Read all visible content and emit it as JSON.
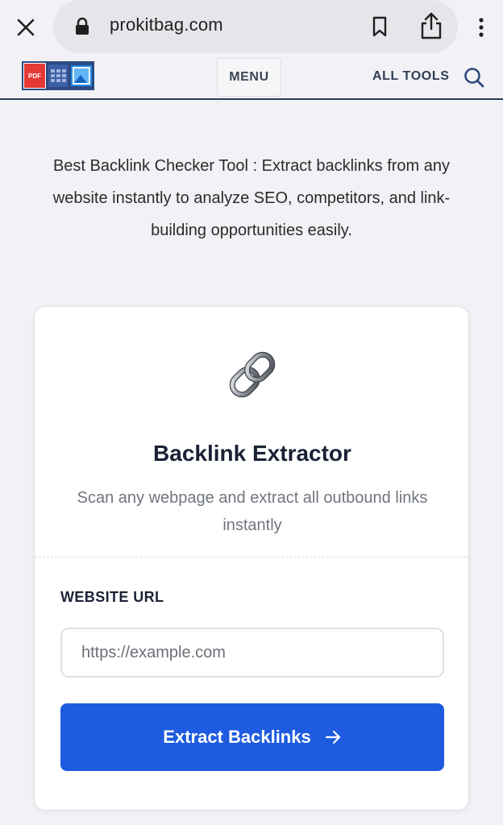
{
  "browser": {
    "url": "prokitbag.com"
  },
  "header": {
    "logo_badge": "PDF",
    "menu_label": "MENU",
    "all_tools_label": "ALL TOOLS"
  },
  "intro": {
    "text": "Best Backlink Checker Tool : Extract backlinks from any website instantly to analyze SEO, competitors, and link-building opportunities easily."
  },
  "card": {
    "title": "Backlink Extractor",
    "subtitle": "Scan any webpage and extract all outbound links instantly",
    "field_label": "WEBSITE URL",
    "input_value": "",
    "input_placeholder": "https://example.com",
    "button_label": "Extract Backlinks"
  },
  "colors": {
    "accent": "#1e5be0",
    "page_bg": "#f2f2f6",
    "header_rule": "#2a3d5a"
  },
  "icons": [
    "close-icon",
    "lock-icon",
    "bookmark-icon",
    "share-icon",
    "more-vert-icon",
    "search-icon",
    "chain-link-icon",
    "arrow-right-icon"
  ]
}
